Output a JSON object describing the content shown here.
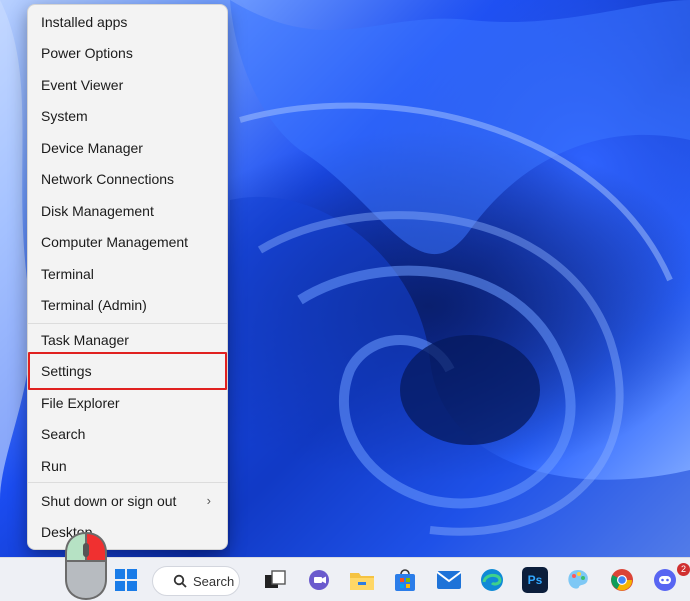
{
  "menu": {
    "items": [
      {
        "label": "Installed apps"
      },
      {
        "label": "Power Options"
      },
      {
        "label": "Event Viewer"
      },
      {
        "label": "System"
      },
      {
        "label": "Device Manager"
      },
      {
        "label": "Network Connections"
      },
      {
        "label": "Disk Management"
      },
      {
        "label": "Computer Management"
      },
      {
        "label": "Terminal"
      },
      {
        "label": "Terminal (Admin)"
      },
      {
        "label": "Task Manager"
      },
      {
        "label": "Settings"
      },
      {
        "label": "File Explorer"
      },
      {
        "label": "Search"
      },
      {
        "label": "Run"
      },
      {
        "label": "Shut down or sign out"
      },
      {
        "label": "Desktop"
      }
    ],
    "highlighted_item": "Settings",
    "highlight_color": "#e0201f",
    "submenu_chevron": "›"
  },
  "taskbar": {
    "search_label": "Search",
    "icons": [
      "windows-start-icon",
      "search-icon",
      "task-view-icon",
      "teams-chat-icon",
      "file-explorer-icon",
      "microsoft-store-icon",
      "mail-icon",
      "edge-icon",
      "photoshop-icon",
      "paint-icon",
      "chrome-icon",
      "discord-icon"
    ],
    "photoshop_label": "Ps",
    "discord_badge": "2"
  }
}
